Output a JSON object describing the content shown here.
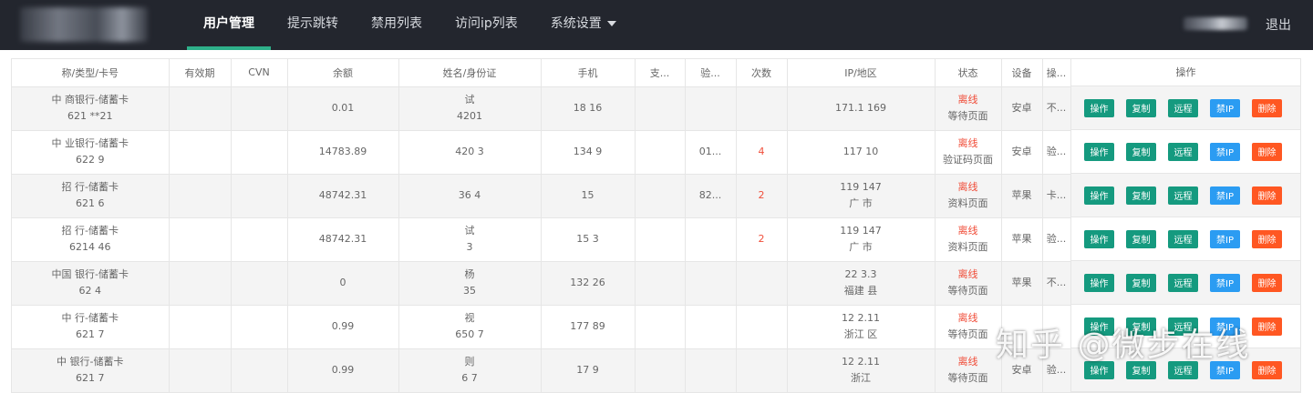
{
  "nav": {
    "items": [
      "用户管理",
      "提示跳转",
      "禁用列表",
      "访问ip列表",
      "系统设置"
    ],
    "logout": "退出"
  },
  "table": {
    "headers": [
      "称/类型/卡号",
      "有效期",
      "CVN",
      "余额",
      "姓名/身份证",
      "手机",
      "支...",
      "验...",
      "次数",
      "IP/地区",
      "状态",
      "设备",
      "操..."
    ],
    "rows": [
      {
        "card1": "中 商银行-储蓄卡",
        "card2": "621 **21",
        "expiry": "",
        "cvn": "",
        "balance": "0.01",
        "name1": "试",
        "name2": "4201",
        "phone": "18 16",
        "pay": "",
        "verify": "",
        "count": "",
        "ip1": "171.1 169",
        "ip2": "",
        "status": "离线",
        "page": "等待页面",
        "device": "安卓",
        "op": "不..."
      },
      {
        "card1": "中 业银行-储蓄卡",
        "card2": "622 9",
        "expiry": "",
        "cvn": "",
        "balance": "14783.89",
        "name1": "",
        "name2": "420 3",
        "phone": "134 9",
        "pay": "",
        "verify": "01...",
        "count": "4",
        "ip1": "117 10",
        "ip2": "",
        "status": "离线",
        "page": "验证码页面",
        "device": "安卓",
        "op": "验..."
      },
      {
        "card1": "招 行-储蓄卡",
        "card2": "621 6",
        "expiry": "",
        "cvn": "",
        "balance": "48742.31",
        "name1": "",
        "name2": "36 4",
        "phone": "15",
        "pay": "",
        "verify": "82...",
        "count": "2",
        "ip1": "119 147",
        "ip2": "广 市",
        "status": "离线",
        "page": "资料页面",
        "device": "苹果",
        "op": "卡..."
      },
      {
        "card1": "招 行-储蓄卡",
        "card2": "6214 46",
        "expiry": "",
        "cvn": "",
        "balance": "48742.31",
        "name1": "试",
        "name2": "3",
        "phone": "15 3",
        "pay": "",
        "verify": "",
        "count": "2",
        "ip1": "119 147",
        "ip2": "广 市",
        "status": "离线",
        "page": "资料页面",
        "device": "苹果",
        "op": "验..."
      },
      {
        "card1": "中国 银行-储蓄卡",
        "card2": "62 4",
        "expiry": "",
        "cvn": "",
        "balance": "0",
        "name1": "杨",
        "name2": "35",
        "phone": "132 26",
        "pay": "",
        "verify": "",
        "count": "",
        "ip1": "22 3.3",
        "ip2": "福建 县",
        "status": "离线",
        "page": "等待页面",
        "device": "苹果",
        "op": "不..."
      },
      {
        "card1": "中 行-储蓄卡",
        "card2": "621 7",
        "expiry": "",
        "cvn": "",
        "balance": "0.99",
        "name1": "视",
        "name2": "650 7",
        "phone": "177 89",
        "pay": "",
        "verify": "",
        "count": "",
        "ip1": "12 2.11",
        "ip2": "浙江 区",
        "status": "离线",
        "page": "等待页面",
        "device": "",
        "op": ""
      },
      {
        "card1": "中 银行-储蓄卡",
        "card2": "621 7",
        "expiry": "",
        "cvn": "",
        "balance": "0.99",
        "name1": "则",
        "name2": "6 7",
        "phone": "17 9",
        "pay": "",
        "verify": "",
        "count": "",
        "ip1": "12 2.11",
        "ip2": "浙江",
        "status": "离线",
        "page": "等待页面",
        "device": "安卓",
        "op": "验..."
      }
    ]
  },
  "ops": {
    "header": "操作",
    "buttons": [
      "操作",
      "复制",
      "远程",
      "禁IP",
      "删除"
    ]
  },
  "watermark": "知乎 @微步在线",
  "colors": {
    "topbar": "#23262e",
    "accent": "#2eb08a",
    "green_btn": "#159a7f",
    "blue_btn": "#2b9cf2",
    "orange_btn": "#ff5722",
    "status_red": "#f04e3a"
  }
}
